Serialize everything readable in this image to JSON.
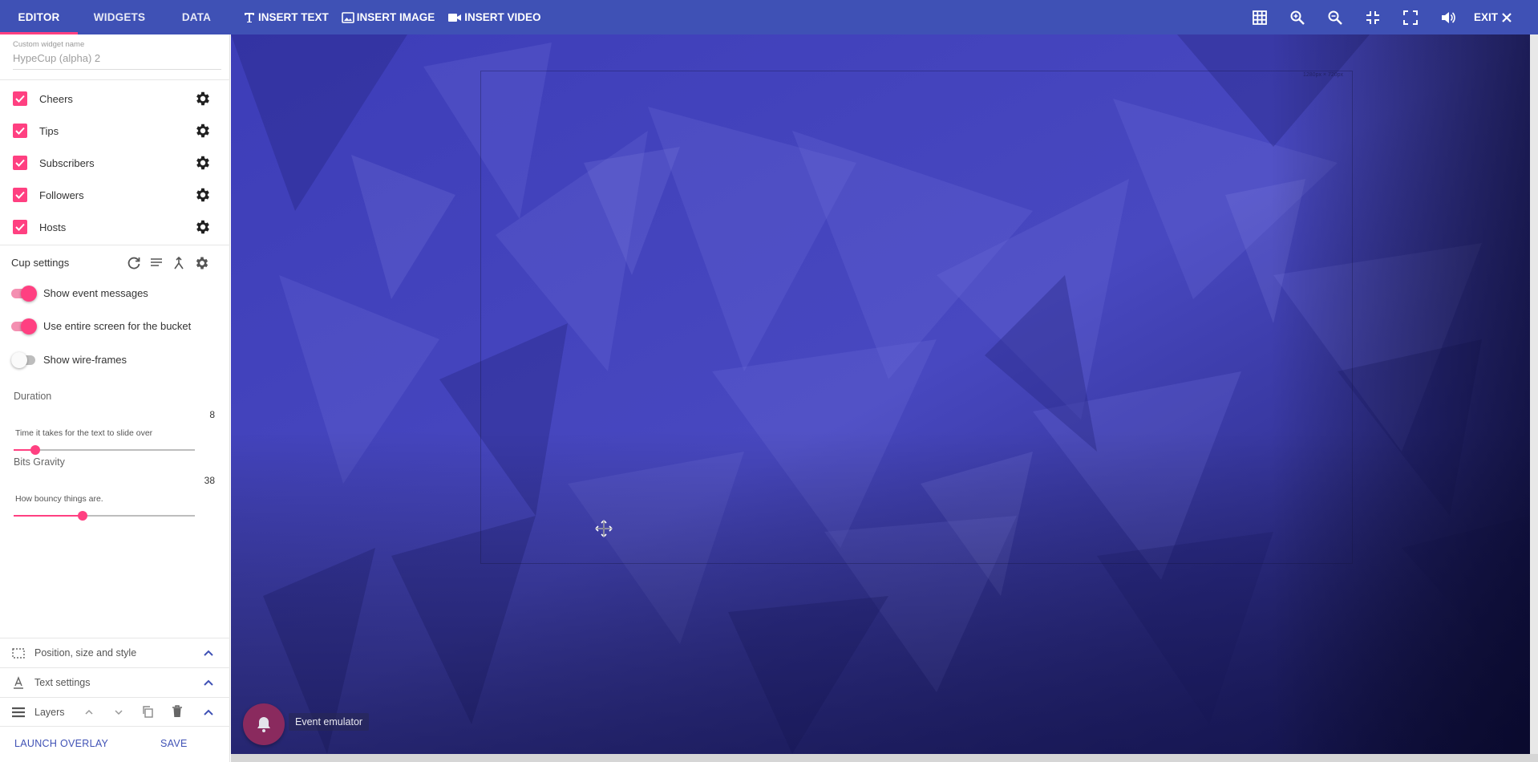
{
  "topbar": {
    "tabs": [
      {
        "label": "EDITOR",
        "active": true
      },
      {
        "label": "WIDGETS",
        "active": false
      },
      {
        "label": "DATA",
        "active": false
      }
    ],
    "insert_text": "INSERT TEXT",
    "insert_image": "INSERT IMAGE",
    "insert_video": "INSERT VIDEO",
    "tools": [
      "grid-icon",
      "zoom-in-icon",
      "zoom-out-icon",
      "fit-screen-icon",
      "fullscreen-icon",
      "volume-icon"
    ],
    "exit": "EXIT"
  },
  "sidebar": {
    "name_label": "Custom widget name",
    "name_value": "HypeCup (alpha) 2",
    "events": [
      {
        "label": "Cheers",
        "checked": true
      },
      {
        "label": "Tips",
        "checked": true
      },
      {
        "label": "Subscribers",
        "checked": true
      },
      {
        "label": "Followers",
        "checked": true
      },
      {
        "label": "Hosts",
        "checked": true
      }
    ],
    "cup_settings": "Cup settings",
    "toggles": [
      {
        "label": "Show event messages",
        "on": true
      },
      {
        "label": "Use entire screen for the bucket",
        "on": true
      },
      {
        "label": "Show wire-frames",
        "on": false
      }
    ],
    "duration": {
      "label": "Duration",
      "value": "8",
      "fraction": 0.12,
      "help": "Time it takes for the text to slide over"
    },
    "gravity": {
      "label": "Bits Gravity",
      "value": "38",
      "fraction": 0.38,
      "help": "How bouncy things are."
    },
    "sections": {
      "position": "Position, size and style",
      "text": "Text settings",
      "layers": "Layers"
    },
    "launch": "LAUNCH OVERLAY",
    "save": "SAVE"
  },
  "canvas": {
    "dimensions": "1280px × 720px",
    "event_emulator": "Event emulator"
  },
  "colors": {
    "primary": "#3f51b5",
    "accent": "#ff4081"
  }
}
